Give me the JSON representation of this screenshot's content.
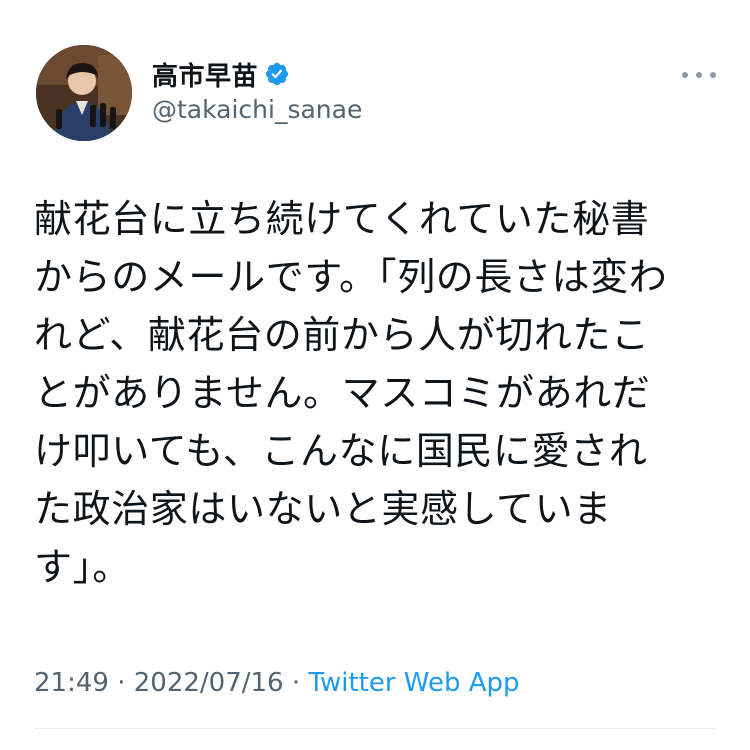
{
  "author": {
    "display_name": "高市早苗",
    "handle": "@takaichi_sanae",
    "verified": true,
    "verified_icon": "verified-badge-icon",
    "verified_color": "#1d9bf0"
  },
  "tweet": {
    "text_lines": [
      "献花台に立ち続けてくれていた秘書",
      "からのメールです。「列の長さは変わ",
      "れど、献花台の前から人が切れたこ",
      "とがありません。マスコミがあれだ",
      "け叩いても、こんなに国民に愛され",
      "た政治家はいないと実感していま",
      "す」。"
    ]
  },
  "meta": {
    "time": "21:49",
    "separator": "·",
    "date": "2022/07/16",
    "source": "Twitter Web App",
    "source_color": "#1d9bf0"
  },
  "icons": {
    "more": "more-options-icon"
  }
}
